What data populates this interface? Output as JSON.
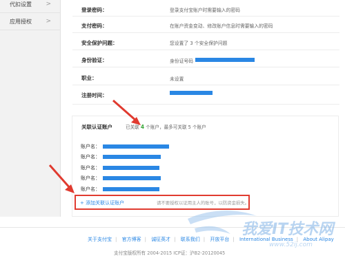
{
  "sidebar": {
    "items": [
      {
        "label": "代扣设置"
      },
      {
        "label": "应用授权"
      }
    ]
  },
  "info": {
    "rows": [
      {
        "label": "登录密码：",
        "value": "登录支付宝账户时需要输入的密码"
      },
      {
        "label": "支付密码：",
        "value": "在账户资金变动、修改账户信息时需要输入的密码"
      },
      {
        "label": "安全保护问题：",
        "value": "您设置了 3 个安全保护问题"
      },
      {
        "label": "身份验证：",
        "value": "身份证号码"
      },
      {
        "label": "职业：",
        "value": "未设置"
      },
      {
        "label": "注册时间：",
        "value": ""
      }
    ]
  },
  "linked": {
    "title": "关联认证账户",
    "count_prefix": "已关联",
    "count_num": "4",
    "count_suffix": "个账户，最多可关联 5 个账户",
    "accounts": [
      {
        "label": "账户名："
      },
      {
        "label": "账户名："
      },
      {
        "label": "账户名："
      },
      {
        "label": "账户名："
      },
      {
        "label": "账户名："
      }
    ],
    "add_label": "+ 添加关联认证账户",
    "add_tip": "请不要授权以证用主人的账号，以防资金损失。"
  },
  "footer": {
    "links": [
      "关于支付宝",
      "官方博客",
      "诚征英才",
      "联系我们",
      "开放平台",
      "International Business",
      "About Alipay"
    ],
    "copyright": "支付宝版权所有 2004-2015 ICP证：沪B2-20120045"
  },
  "watermark": {
    "text": "我爱IT技术网",
    "url": "www.52ij.com"
  },
  "colors": {
    "accent": "#2a87e4",
    "highlight_box": "#e03a2f",
    "count_green": "#3aa63a"
  }
}
